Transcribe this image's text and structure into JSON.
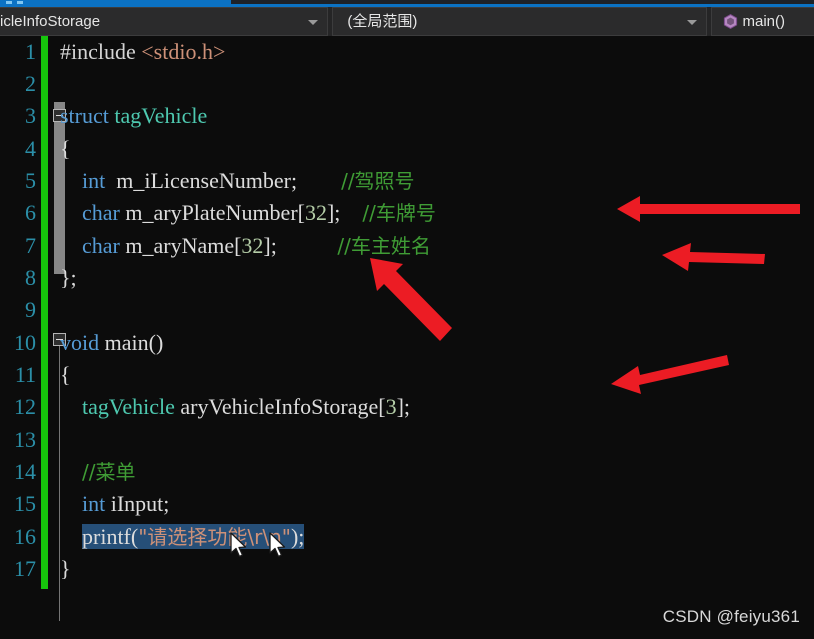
{
  "window": {
    "tabstrip_active": true
  },
  "navbar": {
    "class_combo": {
      "value": "icleInfoStorage",
      "icon": "chevron-down-icon"
    },
    "scope_combo": {
      "value": "(全局范围)",
      "icon": "chevron-down-icon"
    },
    "member_combo": {
      "value": "main()",
      "icon": "method-icon"
    }
  },
  "editor": {
    "line_numbers": [
      "1",
      "2",
      "3",
      "4",
      "5",
      "6",
      "7",
      "8",
      "9",
      "10",
      "11",
      "12",
      "13",
      "14",
      "15",
      "16",
      "17"
    ],
    "selected_line": 16,
    "lines": [
      {
        "n": "1",
        "text": "#include <stdio.h>"
      },
      {
        "n": "2",
        "text": ""
      },
      {
        "n": "3",
        "text": "struct tagVehicle"
      },
      {
        "n": "4",
        "text": "{"
      },
      {
        "n": "5",
        "text": "    int  m_iLicenseNumber;        //驾照号"
      },
      {
        "n": "6",
        "text": "    char m_aryPlateNumber[32];    //车牌号"
      },
      {
        "n": "7",
        "text": "    char m_aryName[32];           //车主姓名"
      },
      {
        "n": "8",
        "text": "};"
      },
      {
        "n": "9",
        "text": ""
      },
      {
        "n": "10",
        "text": "void main()"
      },
      {
        "n": "11",
        "text": "{"
      },
      {
        "n": "12",
        "text": "    tagVehicle aryVehicleInfoStorage[3];"
      },
      {
        "n": "13",
        "text": ""
      },
      {
        "n": "14",
        "text": "    //菜单"
      },
      {
        "n": "15",
        "text": "    int iInput;"
      },
      {
        "n": "16",
        "text": "    printf(\"请选择功能\\r\\n\");"
      },
      {
        "n": "17",
        "text": "}"
      }
    ],
    "tokens": {
      "l1_pre": "#include ",
      "l1_str": "<stdio.h>",
      "l3_kw": "struct ",
      "l3_type": "tagVehicle",
      "l4_brace": "{",
      "l5_kw": "int",
      "l5_id": "  m_iLicenseNumber;",
      "l5_com": "//驾照号",
      "l6_kw": "char",
      "l6_id": " m_aryPlateNumber[",
      "l6_num": "32",
      "l6_tail": "];",
      "l6_com": "//车牌号",
      "l7_kw": "char",
      "l7_id": " m_aryName[",
      "l7_num": "32",
      "l7_tail": "];",
      "l7_com": "//车主姓名",
      "l8_brace": "};",
      "l10_kw": "void ",
      "l10_fn": "main()",
      "l11_brace": "{",
      "l12_type": "tagVehicle",
      "l12_id": " aryVehicleInfoStorage[",
      "l12_num": "3",
      "l12_tail": "];",
      "l14_com": "//菜单",
      "l15_kw": "int",
      "l15_id": " iInput;",
      "l16_fn": "printf(",
      "l16_str": "\"请选择功能\\r\\n\"",
      "l16_tail": ");",
      "l17_brace": "}"
    }
  },
  "annotations": {
    "arrows": [
      {
        "name": "arrow-to-plate-number-comment",
        "direction": "left"
      },
      {
        "name": "arrow-to-owner-name-comment",
        "direction": "left"
      },
      {
        "name": "arrow-to-struct-end",
        "direction": "up-left"
      },
      {
        "name": "arrow-to-array-declaration",
        "direction": "left-down"
      }
    ],
    "color": "#ec1c24"
  },
  "cursors": [
    {
      "name": "mouse-pointer-primary"
    },
    {
      "name": "mouse-pointer-secondary"
    }
  ],
  "watermark": {
    "text": "CSDN @feiyu361"
  }
}
